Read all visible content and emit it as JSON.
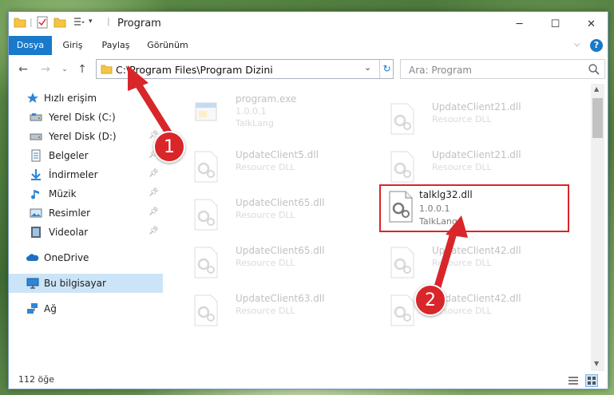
{
  "window": {
    "title": "Program"
  },
  "ribbon": {
    "tabs": [
      "Dosya",
      "Giriş",
      "Paylaş",
      "Görünüm"
    ],
    "help": "?"
  },
  "address": {
    "path": "C:\\Program Files\\Program Dizini"
  },
  "search": {
    "placeholder": "Ara: Program"
  },
  "nav": {
    "items": [
      {
        "label": "Hızlı erişim",
        "icon": "star-icon"
      },
      {
        "label": "Yerel Disk (C:)",
        "icon": "drive-icon"
      },
      {
        "label": "Yerel Disk (D:)",
        "icon": "drive-icon"
      },
      {
        "label": "Belgeler",
        "icon": "documents-icon"
      },
      {
        "label": "İndirmeler",
        "icon": "download-icon"
      },
      {
        "label": "Müzik",
        "icon": "music-icon"
      },
      {
        "label": "Resimler",
        "icon": "pictures-icon"
      },
      {
        "label": "Videolar",
        "icon": "videos-icon"
      },
      {
        "label": "OneDrive",
        "icon": "cloud-icon"
      },
      {
        "label": "Bu bilgisayar",
        "icon": "computer-icon"
      },
      {
        "label": "Ağ",
        "icon": "network-icon"
      }
    ]
  },
  "files": [
    {
      "name": "program.exe",
      "line1": "1.0.0.1",
      "line2": "TalkLang"
    },
    {
      "name": "UpdateClient21.dll",
      "line1": "Resource DLL",
      "line2": ""
    },
    {
      "name": "UpdateClient5.dll",
      "line1": "Resource DLL",
      "line2": ""
    },
    {
      "name": "UpdateClient21.dll",
      "line1": "Resource DLL",
      "line2": ""
    },
    {
      "name": "UpdateClient65.dll",
      "line1": "Resource DLL",
      "line2": ""
    },
    {
      "name": "talklg32.dll",
      "line1": "1.0.0.1",
      "line2": "TalkLang"
    },
    {
      "name": "UpdateClient65.dll",
      "line1": "Resource DLL",
      "line2": ""
    },
    {
      "name": "UpdateClient42.dll",
      "line1": "Resource DLL",
      "line2": ""
    },
    {
      "name": "UpdateClient63.dll",
      "line1": "Resource DLL",
      "line2": ""
    },
    {
      "name": "UpdateClient42.dll",
      "line1": "Resource DLL",
      "line2": ""
    }
  ],
  "status": {
    "count": "112 öğe"
  },
  "annotations": {
    "step1": "1",
    "step2": "2",
    "color": "#d8262a"
  },
  "colors": {
    "accent": "#1979ca",
    "selection": "#cce4f7"
  }
}
